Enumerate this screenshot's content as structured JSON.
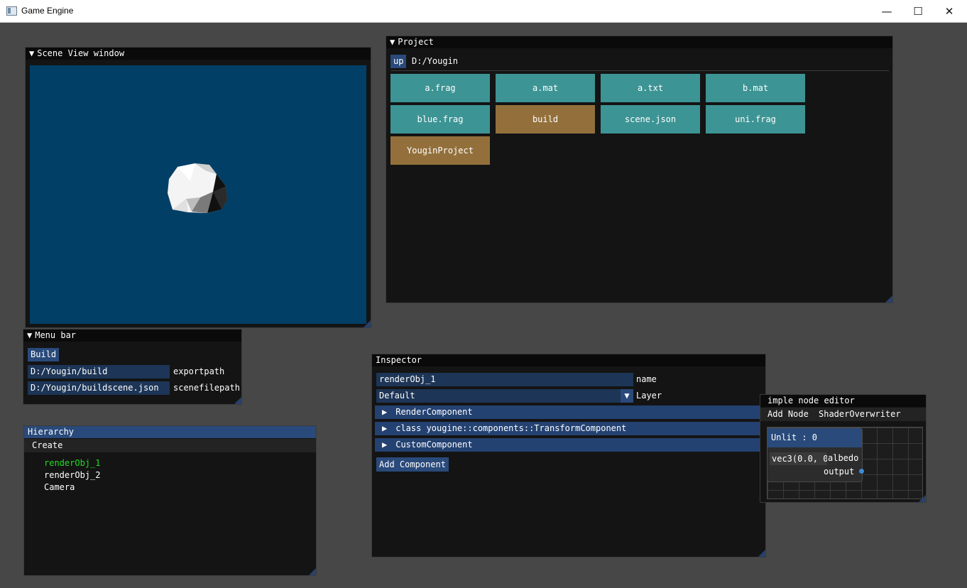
{
  "window": {
    "title": "Game Engine",
    "min_glyph": "—",
    "max_glyph": "☐",
    "close_glyph": "✕"
  },
  "scene_view": {
    "title": "Scene View window",
    "background": "#023f66"
  },
  "project": {
    "title": "Project",
    "up_label": "up",
    "path": "D:/Yougin",
    "items": [
      {
        "label": "a.frag",
        "kind": "file"
      },
      {
        "label": "a.mat",
        "kind": "file"
      },
      {
        "label": "a.txt",
        "kind": "file"
      },
      {
        "label": "b.mat",
        "kind": "file"
      },
      {
        "label": "blue.frag",
        "kind": "file"
      },
      {
        "label": "build",
        "kind": "folder"
      },
      {
        "label": "scene.json",
        "kind": "file"
      },
      {
        "label": "uni.frag",
        "kind": "file"
      },
      {
        "label": "YouginProject",
        "kind": "folder"
      }
    ]
  },
  "menu_bar": {
    "title": "Menu bar",
    "build_label": "Build",
    "export_value": "D:/Yougin/build",
    "export_label": "exportpath",
    "scene_value": "D:/Yougin/buildscene.json",
    "scene_label": "scenefilepath"
  },
  "hierarchy": {
    "title": "Hierarchy",
    "create_label": "Create",
    "items": [
      "renderObj_1",
      "renderObj_2",
      "Camera"
    ],
    "selected_color": "#22dd22"
  },
  "inspector": {
    "title": "Inspector",
    "name_value": "renderObj_1",
    "name_label": "name",
    "layer_value": "Default",
    "layer_label": "Layer",
    "components": [
      "RenderComponent",
      "class yougine::components::TransformComponent",
      "CustomComponent"
    ],
    "add_component_label": "Add Component"
  },
  "node_editor": {
    "title": "imple node editor",
    "menu": [
      "Add Node",
      "ShaderOverwriter"
    ],
    "node_title": "Unlit : 0",
    "node_input_value": "vec3(0.0, 0.",
    "node_input_label": "albedo",
    "node_output_label": "output"
  }
}
